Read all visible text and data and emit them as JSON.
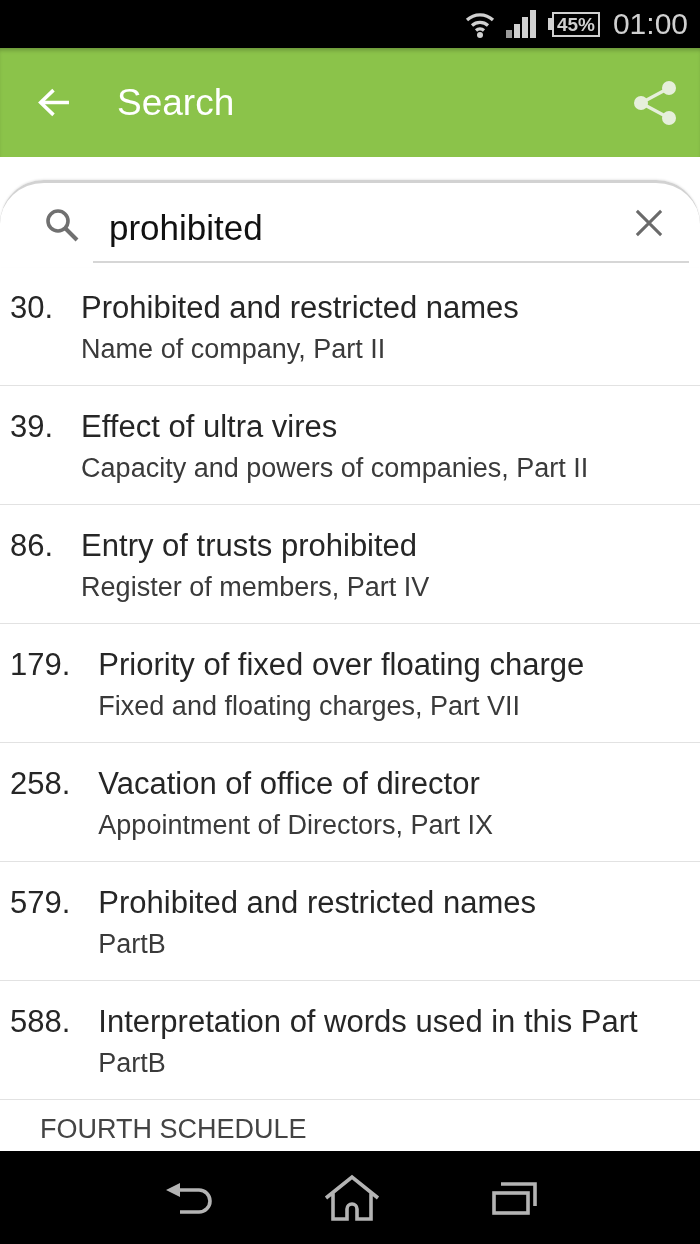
{
  "status_bar": {
    "battery": "45%",
    "time": "01:00"
  },
  "app_bar": {
    "title": "Search"
  },
  "search": {
    "value": "prohibited"
  },
  "results": [
    {
      "number": "30.",
      "title": "Prohibited and restricted names",
      "subtitle": "Name of company, Part II"
    },
    {
      "number": "39.",
      "title": "Effect of ultra vires",
      "subtitle": "Capacity and powers of companies, Part II"
    },
    {
      "number": "86.",
      "title": "Entry of trusts prohibited",
      "subtitle": "Register of members, Part IV"
    },
    {
      "number": "179.",
      "title": "Priority of fixed over floating charge",
      "subtitle": "Fixed and floating charges, Part VII"
    },
    {
      "number": "258.",
      "title": "Vacation of office of director",
      "subtitle": "Appointment of Directors, Part IX"
    },
    {
      "number": "579.",
      "title": "Prohibited and restricted names",
      "subtitle": "PartB"
    },
    {
      "number": "588.",
      "title": "Interpretation of words used in this Part",
      "subtitle": "PartB"
    }
  ],
  "next_section": {
    "title": "FOURTH SCHEDULE"
  }
}
